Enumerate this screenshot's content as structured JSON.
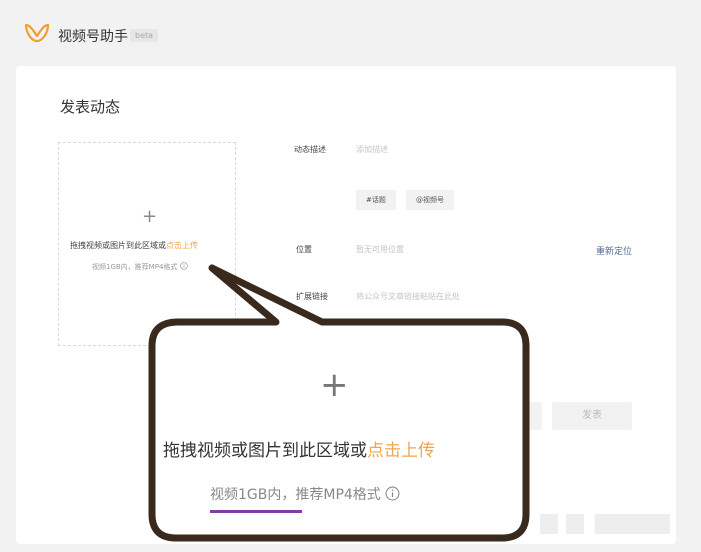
{
  "header": {
    "logo_icon": "wechat-channels-logo",
    "title": "视频号助手",
    "badge": "beta"
  },
  "page": {
    "title": "发表动态"
  },
  "upload": {
    "plus_icon": "plus-icon",
    "text_before_link": "拖拽视频或图片到此区域或",
    "link_text": "点击上传",
    "hint": "视频1GB内，推荐MP4格式",
    "info_icon": "info-icon"
  },
  "form": {
    "description_label": "动态描述",
    "description_placeholder": "添加描述",
    "topic_tag": "#话题",
    "mention_tag": "@视频号",
    "location_label": "位置",
    "location_placeholder": "暂无可用位置",
    "relocate_link": "重新定位",
    "extlink_label": "扩展链接",
    "extlink_placeholder": "将公众号文章链接粘贴在此处"
  },
  "actions": {
    "publish_label": "发表"
  },
  "callout": {
    "plus_icon": "plus-icon",
    "text_before_link": "拖拽视频或图片到此区域或",
    "link_text": "点击上传",
    "hint": "视频1GB内，推荐MP4格式",
    "info_icon": "info-icon"
  },
  "colors": {
    "link_orange": "#f0a54d",
    "relocate_blue": "#576b95",
    "callout_border": "#3a2a1e",
    "underline_purple": "#7b3fa6",
    "logo_orange": "#f0a030"
  }
}
